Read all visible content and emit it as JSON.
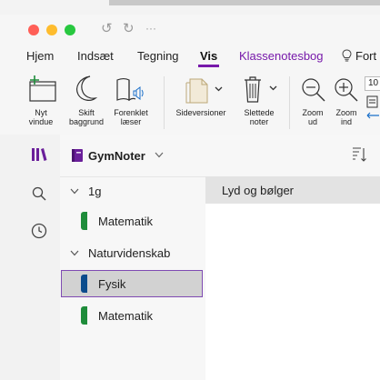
{
  "window": {
    "title_buttons": [
      "close",
      "minimize",
      "zoom"
    ],
    "quick_access": {
      "undo": "↺",
      "redo": "↻",
      "more": "···"
    }
  },
  "menu": {
    "tabs": [
      "Hjem",
      "Indsæt",
      "Tegning",
      "Vis",
      "Klassenotesbog",
      "Fort"
    ],
    "active_tab": "Vis"
  },
  "ribbon": {
    "new_window": {
      "line1": "Nyt",
      "line2": "vindue"
    },
    "switch_background": {
      "line1": "Skift",
      "line2": "baggrund"
    },
    "immersive_reader": {
      "line1": "Forenklet",
      "line2": "læser"
    },
    "page_versions": {
      "line1": "Sideversioner"
    },
    "deleted_notes": {
      "line1": "Slettede",
      "line2": "noter"
    },
    "zoom_out": {
      "line1": "Zoom",
      "line2": "ud"
    },
    "zoom_in": {
      "line1": "Zoom",
      "line2": "ind"
    },
    "zoom_value": "10"
  },
  "notebook": {
    "name": "GymNoter",
    "sections": [
      {
        "group": "1g",
        "items": [
          {
            "label": "Matematik",
            "color": "#1e8c3a"
          }
        ]
      },
      {
        "group": "Naturvidenskab",
        "items": [
          {
            "label": "Fysik",
            "color": "#0b4c8c",
            "selected": true
          },
          {
            "label": "Matematik",
            "color": "#1e8c3a"
          }
        ]
      }
    ]
  },
  "pages": [
    {
      "title": "Lyd og bølger"
    }
  ],
  "colors": {
    "accent": "#7719aa",
    "selection_border": "#7f4bb3"
  }
}
